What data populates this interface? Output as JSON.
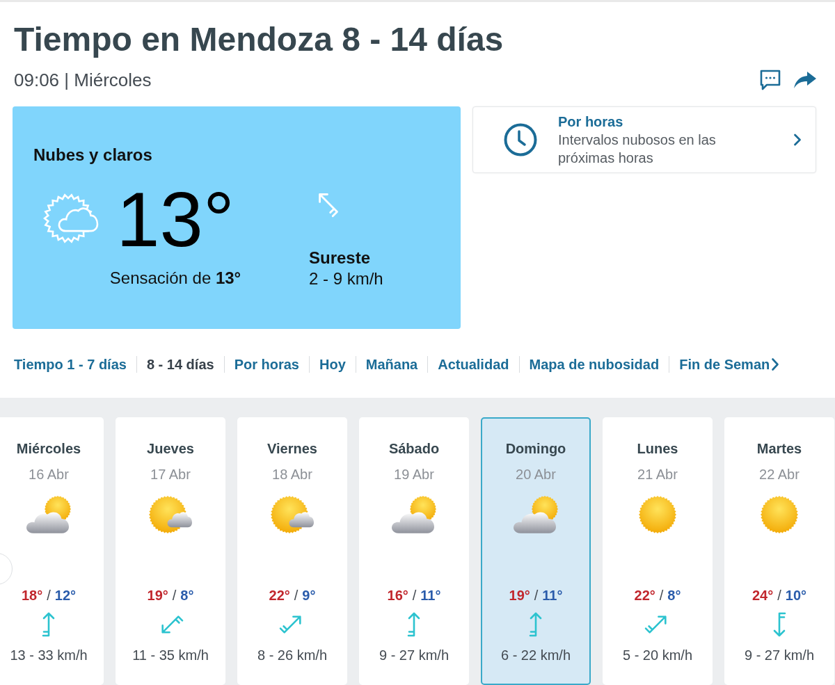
{
  "header": {
    "title": "Tiempo en Mendoza 8 - 14 días",
    "updated": "09:06 | Miércoles"
  },
  "current": {
    "condition": "Nubes y claros",
    "icon": {
      "kind": "partly"
    },
    "temperature": "13°",
    "feels_like": "Sensación de **13°**",
    "wind_icon": {
      "kind": "northwest"
    },
    "wind_direction": "Sureste",
    "wind_speed": "2 - 9 km/h"
  },
  "hourly_card": {
    "title": "Por horas",
    "description": "Intervalos nubosos en las próximas horas"
  },
  "nav": {
    "items": [
      {
        "label": "Tiempo 1 - 7 días",
        "selected": false
      },
      {
        "label": "8 - 14 días",
        "selected": true
      },
      {
        "label": "Por horas",
        "selected": false
      },
      {
        "label": "Hoy",
        "selected": false
      },
      {
        "label": "Mañana",
        "selected": false
      },
      {
        "label": "Actualidad",
        "selected": false
      },
      {
        "label": "Mapa de nubosidad",
        "selected": false
      },
      {
        "label": "Fin de Seman",
        "selected": false
      }
    ]
  },
  "days": [
    {
      "day": "Miércoles",
      "date": "16 Abr",
      "icon": {
        "kind": "cloudy"
      },
      "max": "18°",
      "separator": "/",
      "min": "12°",
      "wind_icon": {
        "kind": "north"
      },
      "wind": "13 - 33 km/h",
      "selected": false
    },
    {
      "day": "Jueves",
      "date": "17 Abr",
      "icon": {
        "kind": "partly"
      },
      "max": "19°",
      "separator": "/",
      "min": "8°",
      "wind_icon": {
        "kind": "southwest"
      },
      "wind": "11 - 35 km/h",
      "selected": false
    },
    {
      "day": "Viernes",
      "date": "18 Abr",
      "icon": {
        "kind": "partly"
      },
      "max": "22°",
      "separator": "/",
      "min": "9°",
      "wind_icon": {
        "kind": "northeast"
      },
      "wind": "8 - 26 km/h",
      "selected": false
    },
    {
      "day": "Sábado",
      "date": "19 Abr",
      "icon": {
        "kind": "cloudy"
      },
      "max": "16°",
      "separator": "/",
      "min": "11°",
      "wind_icon": {
        "kind": "north"
      },
      "wind": "9 - 27 km/h",
      "selected": false
    },
    {
      "day": "Domingo",
      "date": "20 Abr",
      "icon": {
        "kind": "cloudy"
      },
      "max": "19°",
      "separator": "/",
      "min": "11°",
      "wind_icon": {
        "kind": "north"
      },
      "wind": "6 - 22 km/h",
      "selected": true
    },
    {
      "day": "Lunes",
      "date": "21 Abr",
      "icon": {
        "kind": "sunny"
      },
      "max": "22°",
      "separator": "/",
      "min": "8°",
      "wind_icon": {
        "kind": "northeast"
      },
      "wind": "5 - 20 km/h",
      "selected": false
    },
    {
      "day": "Martes",
      "date": "22 Abr",
      "icon": {
        "kind": "sunny"
      },
      "max": "24°",
      "separator": "/",
      "min": "10°",
      "wind_icon": {
        "kind": "south"
      },
      "wind": "9 - 27 km/h",
      "selected": false
    }
  ]
}
